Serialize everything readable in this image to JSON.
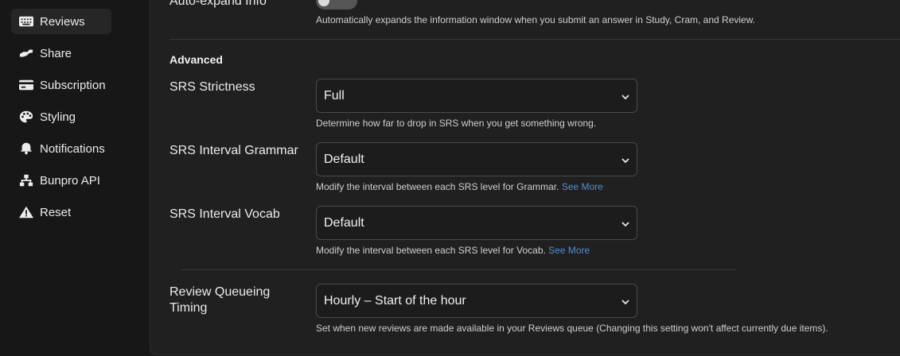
{
  "sidebar": {
    "items": [
      {
        "label": "Reviews",
        "icon": "keyboard-icon",
        "active": true
      },
      {
        "label": "Share",
        "icon": "hand-share-icon"
      },
      {
        "label": "Subscription",
        "icon": "credit-card-icon"
      },
      {
        "label": "Styling",
        "icon": "palette-icon"
      },
      {
        "label": "Notifications",
        "icon": "bell-icon"
      },
      {
        "label": "Bunpro API",
        "icon": "network-icon"
      },
      {
        "label": "Reset",
        "icon": "warning-icon"
      }
    ]
  },
  "autoexpand": {
    "label": "Auto-expand Info",
    "description": "Automatically expands the information window when you submit an answer in Study, Cram, and Review."
  },
  "advanced": {
    "heading": "Advanced",
    "srs_strictness": {
      "label": "SRS Strictness",
      "value": "Full",
      "description": "Determine how far to drop in SRS when you get something wrong."
    },
    "srs_grammar": {
      "label": "SRS Interval Grammar",
      "value": "Default",
      "description": "Modify the interval between each SRS level for Grammar.",
      "link": "See More"
    },
    "srs_vocab": {
      "label": "SRS Interval Vocab",
      "value": "Default",
      "description": "Modify the interval between each SRS level for Vocab.",
      "link": "See More"
    },
    "queue_timing": {
      "label_line1": "Review Queueing",
      "label_line2": "Timing",
      "value": "Hourly – Start of the hour",
      "description": "Set when new reviews are made available in your Reviews queue (Changing this setting won't affect currently due items)."
    }
  },
  "colors": {
    "accent_link": "#4f8fd6",
    "background": "#171717",
    "panel": "#202020"
  }
}
